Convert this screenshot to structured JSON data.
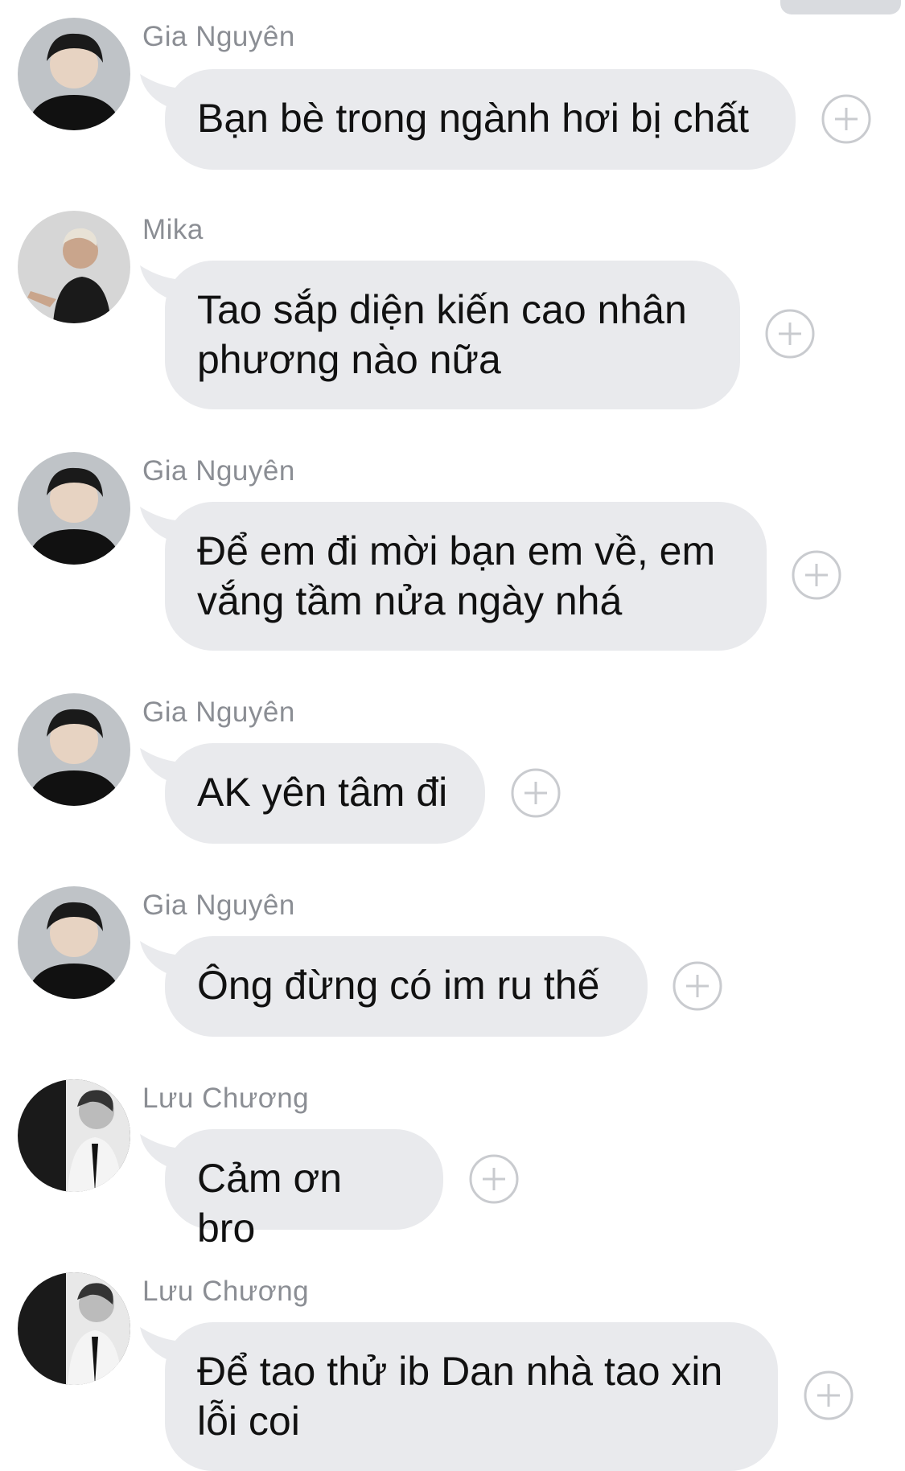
{
  "messages": [
    {
      "sender": "Gia Nguyên",
      "avatar": "avatar-gia-nguyen",
      "text": "Bạn bè trong ngành hơi bị chất"
    },
    {
      "sender": "Mika",
      "avatar": "avatar-mika",
      "text": "Tao sắp diện kiến cao nhân\nphương nào nữa"
    },
    {
      "sender": "Gia Nguyên",
      "avatar": "avatar-gia-nguyen",
      "text": "Để em đi mời bạn em về, em\nvắng tầm nửa ngày nhá"
    },
    {
      "sender": "Gia Nguyên",
      "avatar": "avatar-gia-nguyen",
      "text": "AK yên tâm đi"
    },
    {
      "sender": "Gia Nguyên",
      "avatar": "avatar-gia-nguyen",
      "text": "Ông đừng có im ru thế"
    },
    {
      "sender": "Lưu Chương",
      "avatar": "avatar-luu-chuong",
      "text": "Cảm ơn bro"
    },
    {
      "sender": "Lưu Chương",
      "avatar": "avatar-luu-chuong",
      "text": "Để tao thử ib Dan nhà tao xin\nlỗi coi"
    }
  ],
  "icons": {
    "reaction": "add-reaction-icon"
  },
  "colors": {
    "bubble": "#e9eaed",
    "sender": "#8b8e94",
    "text": "#111111",
    "icon_stroke": "#c9cbcf"
  }
}
